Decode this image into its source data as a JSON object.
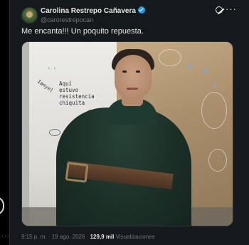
{
  "post": {
    "author_name": "Carolina Restrepo Cañavera",
    "author_handle": "@carorestrepocan",
    "text": "Me encanta!!! Un poquito repuesta.",
    "time": "9:15 p. m.",
    "separator": "·",
    "date": "19 ago. 2026",
    "views_count": "129,9 mil",
    "views_label": "Visualizaciones"
  },
  "image": {
    "wall_writing_1": "Aquí",
    "wall_writing_2": "estuvo",
    "wall_writing_3": "resistencia",
    "wall_writing_4": "chiquita",
    "wall_writing_side": "Ianyel",
    "wall_writing_top": "ᴸ ᴸ"
  },
  "icons": [
    "verified-icon",
    "grok-icon",
    "more-icon"
  ],
  "colors": {
    "verified": "#1d9bf0",
    "background": "#15181c",
    "secondary_text": "#71767b"
  }
}
